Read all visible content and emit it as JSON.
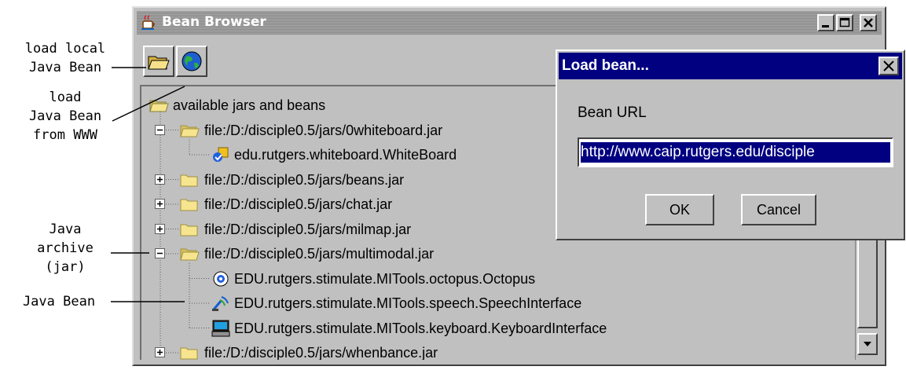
{
  "annotations": {
    "load_local": [
      "load local",
      "Java Bean"
    ],
    "load_www": [
      "load",
      "Java Bean",
      "from WWW"
    ],
    "jar": [
      "Java",
      "archive",
      "(jar)"
    ],
    "bean": [
      "Java Bean"
    ]
  },
  "window": {
    "title": "Bean Browser",
    "title_icon": "java-cup-icon",
    "controls": [
      "minimize-icon",
      "maximize-icon",
      "close-icon"
    ]
  },
  "toolbar": {
    "buttons": [
      {
        "icon": "open-folder-icon"
      },
      {
        "icon": "globe-icon"
      }
    ]
  },
  "tree": {
    "root": "available jars and beans",
    "items": [
      {
        "label": "file:/D:/disciple0.5/jars/0whiteboard.jar",
        "expander": "−",
        "icon": "open-folder-icon"
      },
      {
        "label": "edu.rutgers.whiteboard.WhiteBoard",
        "icon": "whiteboard-bean-icon"
      },
      {
        "label": "file:/D:/disciple0.5/jars/beans.jar",
        "expander": "+",
        "icon": "folder-icon"
      },
      {
        "label": "file:/D:/disciple0.5/jars/chat.jar",
        "expander": "+",
        "icon": "folder-icon"
      },
      {
        "label": "file:/D:/disciple0.5/jars/milmap.jar",
        "expander": "+",
        "icon": "folder-icon"
      },
      {
        "label": "file:/D:/disciple0.5/jars/multimodal.jar",
        "expander": "−",
        "icon": "open-folder-icon"
      },
      {
        "label": "EDU.rutgers.stimulate.MITools.octopus.Octopus",
        "icon": "octopus-bean-icon"
      },
      {
        "label": "EDU.rutgers.stimulate.MITools.speech.SpeechInterface",
        "icon": "speech-bean-icon"
      },
      {
        "label": "EDU.rutgers.stimulate.MITools.keyboard.KeyboardInterface",
        "icon": "keyboard-bean-icon"
      },
      {
        "label": "file:/D:/disciple0.5/jars/whenbance.jar",
        "expander": "+",
        "icon": "folder-icon"
      }
    ]
  },
  "dialog": {
    "title": "Load bean...",
    "field_label": "Bean URL",
    "url_value": "http://www.caip.rutgers.edu/disciple",
    "ok_label": "OK",
    "cancel_label": "Cancel"
  },
  "colors": {
    "window_bg": "#c0c0c0",
    "dialog_title_bg": "#000080",
    "selection_bg": "#000080",
    "folder": "#f0e08a"
  }
}
